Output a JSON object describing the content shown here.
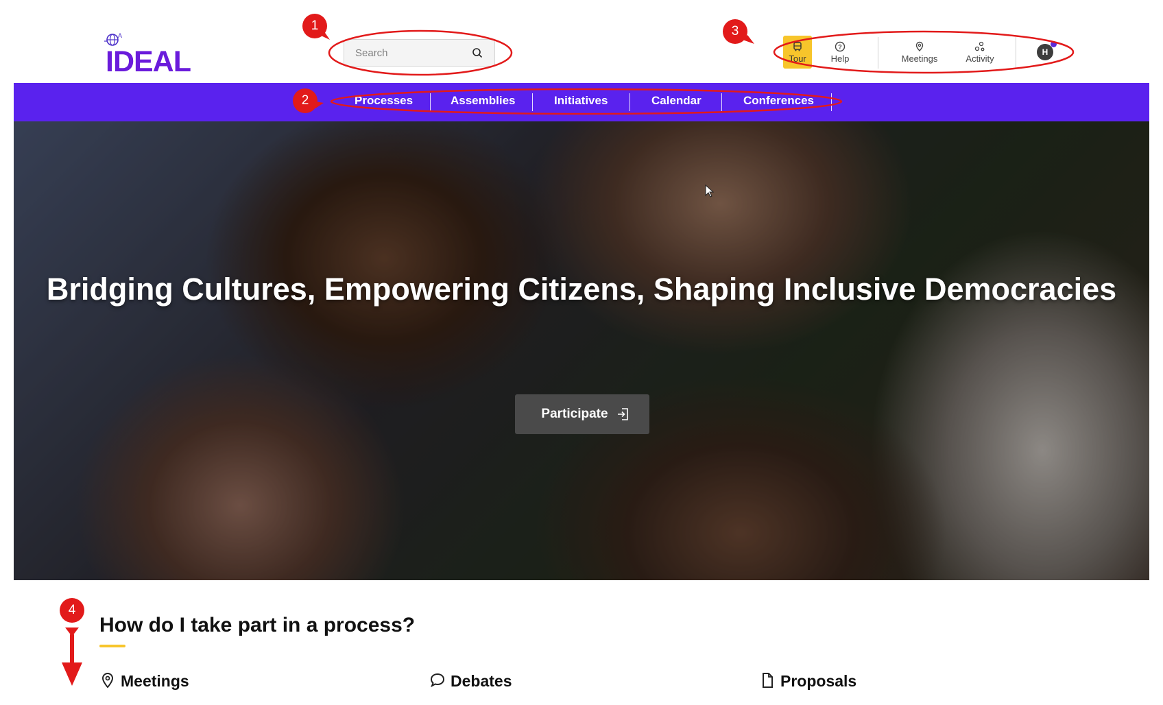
{
  "header": {
    "logo_text": "IDEAL",
    "search": {
      "placeholder": "Search"
    },
    "icons": {
      "tour": "Tour",
      "help": "Help",
      "meetings": "Meetings",
      "activity": "Activity"
    },
    "avatar_initial": "H"
  },
  "menu": [
    {
      "label": "Processes"
    },
    {
      "label": "Assemblies"
    },
    {
      "label": "Initiatives"
    },
    {
      "label": "Calendar"
    },
    {
      "label": "Conferences"
    }
  ],
  "hero": {
    "title": "Bridging Cultures, Empowering Citizens, Shaping Inclusive Democracies",
    "cta_label": "Participate"
  },
  "section": {
    "title": "How do I take part in a process?",
    "features": [
      {
        "label": "Meetings",
        "icon": "map-pin-icon"
      },
      {
        "label": "Debates",
        "icon": "speech-bubble-icon"
      },
      {
        "label": "Proposals",
        "icon": "document-icon"
      }
    ]
  },
  "annotations": {
    "badges": [
      "1",
      "2",
      "3",
      "4"
    ],
    "color": "#e21a1a"
  },
  "colors": {
    "brand_purple": "#5a22ee",
    "accent_yellow": "#f7c52b",
    "button_dark": "#4a4a4a"
  }
}
